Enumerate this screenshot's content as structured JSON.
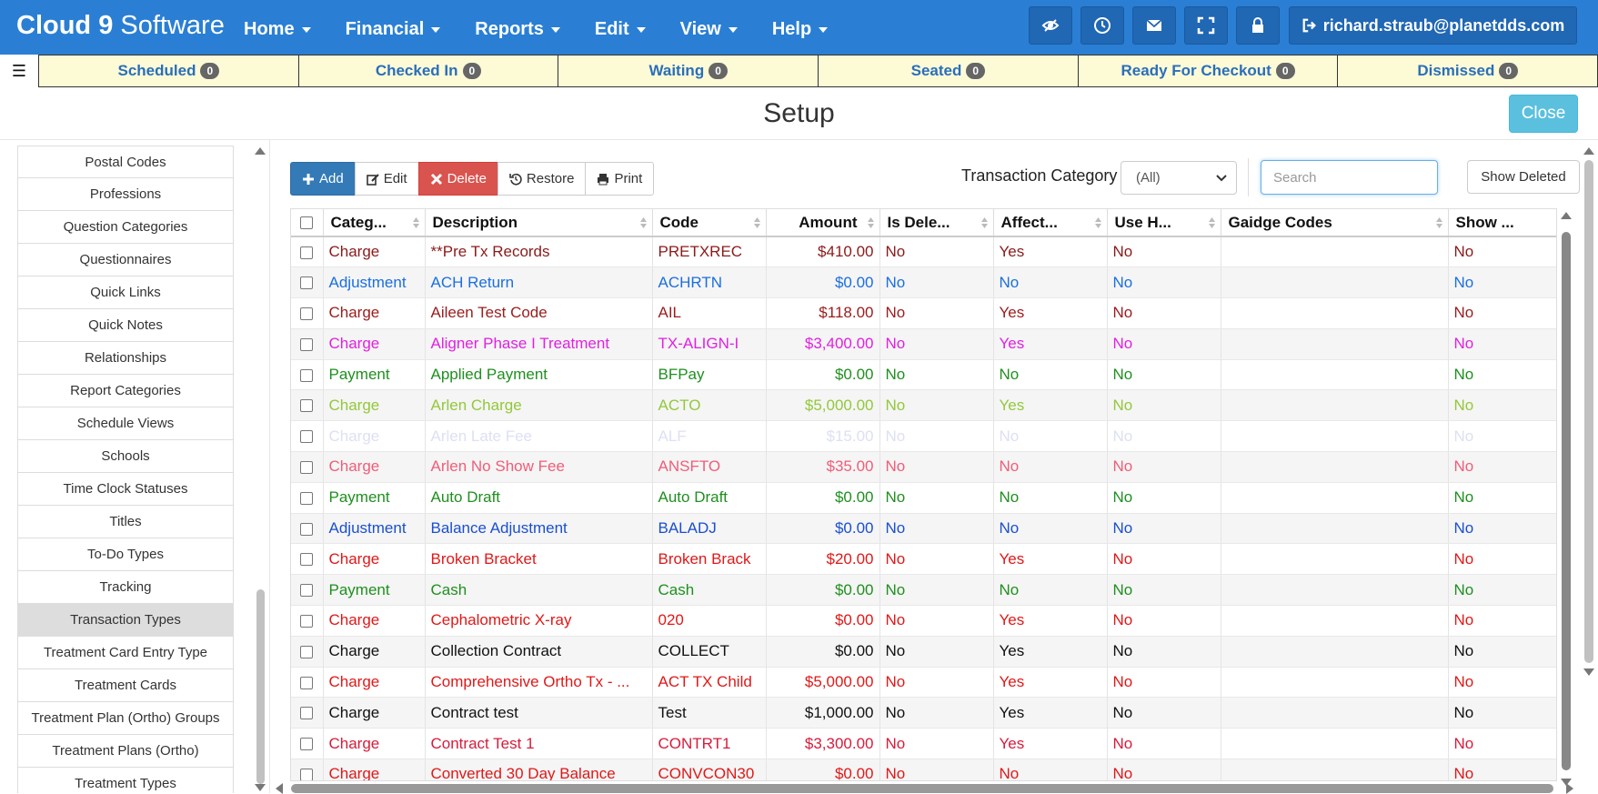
{
  "app": {
    "brand_bold": "Cloud 9",
    "brand_light": " Software",
    "nav": [
      "Home",
      "Financial",
      "Reports",
      "Edit",
      "View",
      "Help"
    ],
    "toolbar_icons": [
      "eye-slash-icon",
      "clock-icon",
      "envelope-icon",
      "fullscreen-icon",
      "lock-icon"
    ],
    "user": "richard.straub@planetdds.com",
    "brand_color": "#2a7fd4"
  },
  "status_bar": [
    {
      "label": "Scheduled",
      "count": "0"
    },
    {
      "label": "Checked In",
      "count": "0"
    },
    {
      "label": "Waiting",
      "count": "0"
    },
    {
      "label": "Seated",
      "count": "0"
    },
    {
      "label": "Ready For Checkout",
      "count": "0"
    },
    {
      "label": "Dismissed",
      "count": "0"
    }
  ],
  "page": {
    "title": "Setup",
    "close_label": "Close"
  },
  "sidebar": {
    "items": [
      "Postal Codes",
      "Professions",
      "Question Categories",
      "Questionnaires",
      "Quick Links",
      "Quick Notes",
      "Relationships",
      "Report Categories",
      "Schedule Views",
      "Schools",
      "Time Clock Statuses",
      "Titles",
      "To-Do Types",
      "Tracking",
      "Transaction Types",
      "Treatment Card Entry Type",
      "Treatment Cards",
      "Treatment Plan (Ortho) Groups",
      "Treatment Plans (Ortho)",
      "Treatment Types"
    ],
    "active": "Transaction Types"
  },
  "toolbar": {
    "add": "Add",
    "edit": "Edit",
    "delete": "Delete",
    "restore": "Restore",
    "print": "Print",
    "filter_label": "Transaction Category",
    "filter_value": "(All)",
    "search_placeholder": "Search",
    "show_deleted": "Show Deleted"
  },
  "grid": {
    "columns": [
      "Categ...",
      "Description",
      "Code",
      "Amount",
      "Is Dele...",
      "Affect...",
      "Use H...",
      "Gaidge Codes",
      "Show ..."
    ],
    "rows": [
      {
        "category": "Charge",
        "description": "**Pre Tx Records",
        "code": "PRETXREC",
        "amount": "$410.00",
        "is_deleted": "No",
        "affects": "Yes",
        "use_h": "No",
        "gaidge": "",
        "show": "No",
        "color": "#8b1a1a"
      },
      {
        "category": "Adjustment",
        "description": "ACH Return",
        "code": "ACHRTN",
        "amount": "$0.00",
        "is_deleted": "No",
        "affects": "No",
        "use_h": "No",
        "gaidge": "",
        "show": "No",
        "color": "#1a6fe0"
      },
      {
        "category": "Charge",
        "description": "Aileen Test Code",
        "code": "AIL",
        "amount": "$118.00",
        "is_deleted": "No",
        "affects": "Yes",
        "use_h": "No",
        "gaidge": "",
        "show": "No",
        "color": "#9b1c1c"
      },
      {
        "category": "Charge",
        "description": "Aligner Phase I Treatment",
        "code": "TX-ALIGN-I",
        "amount": "$3,400.00",
        "is_deleted": "No",
        "affects": "Yes",
        "use_h": "No",
        "gaidge": "",
        "show": "No",
        "color": "#e21fe2"
      },
      {
        "category": "Payment",
        "description": "Applied Payment",
        "code": "BFPay",
        "amount": "$0.00",
        "is_deleted": "No",
        "affects": "No",
        "use_h": "No",
        "gaidge": "",
        "show": "No",
        "color": "#1f8f1f"
      },
      {
        "category": "Charge",
        "description": "Arlen Charge",
        "code": "ACTO",
        "amount": "$5,000.00",
        "is_deleted": "No",
        "affects": "Yes",
        "use_h": "No",
        "gaidge": "",
        "show": "No",
        "color": "#93c83a"
      },
      {
        "category": "Charge",
        "description": "Arlen Late Fee",
        "code": "ALF",
        "amount": "$15.00",
        "is_deleted": "No",
        "affects": "No",
        "use_h": "No",
        "gaidge": "",
        "show": "No",
        "color": "#dde0f3"
      },
      {
        "category": "Charge",
        "description": "Arlen No Show Fee",
        "code": "ANSFTO",
        "amount": "$35.00",
        "is_deleted": "No",
        "affects": "No",
        "use_h": "No",
        "gaidge": "",
        "show": "No",
        "color": "#f05d78"
      },
      {
        "category": "Payment",
        "description": "Auto Draft",
        "code": "Auto Draft",
        "amount": "$0.00",
        "is_deleted": "No",
        "affects": "No",
        "use_h": "No",
        "gaidge": "",
        "show": "No",
        "color": "#1f8f1f"
      },
      {
        "category": "Adjustment",
        "description": "Balance Adjustment",
        "code": "BALADJ",
        "amount": "$0.00",
        "is_deleted": "No",
        "affects": "No",
        "use_h": "No",
        "gaidge": "",
        "show": "No",
        "color": "#1a4fd0"
      },
      {
        "category": "Charge",
        "description": "Broken Bracket",
        "code": "Broken Brack",
        "amount": "$20.00",
        "is_deleted": "No",
        "affects": "Yes",
        "use_h": "No",
        "gaidge": "",
        "show": "No",
        "color": "#e01818"
      },
      {
        "category": "Payment",
        "description": "Cash",
        "code": "Cash",
        "amount": "$0.00",
        "is_deleted": "No",
        "affects": "No",
        "use_h": "No",
        "gaidge": "",
        "show": "No",
        "color": "#1f8f1f"
      },
      {
        "category": "Charge",
        "description": "Cephalometric X-ray",
        "code": "020",
        "amount": "$0.00",
        "is_deleted": "No",
        "affects": "Yes",
        "use_h": "No",
        "gaidge": "",
        "show": "No",
        "color": "#e01818"
      },
      {
        "category": "Charge",
        "description": "Collection Contract",
        "code": "COLLECT",
        "amount": "$0.00",
        "is_deleted": "No",
        "affects": "Yes",
        "use_h": "No",
        "gaidge": "",
        "show": "No",
        "color": "#111111"
      },
      {
        "category": "Charge",
        "description": "Comprehensive Ortho Tx - ...",
        "code": "ACT TX Child",
        "amount": "$5,000.00",
        "is_deleted": "No",
        "affects": "Yes",
        "use_h": "No",
        "gaidge": "",
        "show": "No",
        "color": "#e01818"
      },
      {
        "category": "Charge",
        "description": "Contract test",
        "code": "Test",
        "amount": "$1,000.00",
        "is_deleted": "No",
        "affects": "Yes",
        "use_h": "No",
        "gaidge": "",
        "show": "No",
        "color": "#111111"
      },
      {
        "category": "Charge",
        "description": "Contract Test 1",
        "code": "CONTRT1",
        "amount": "$3,300.00",
        "is_deleted": "No",
        "affects": "Yes",
        "use_h": "No",
        "gaidge": "",
        "show": "No",
        "color": "#d81b3a"
      },
      {
        "category": "Charge",
        "description": "Converted 30 Day Balance",
        "code": "CONVCON30",
        "amount": "$0.00",
        "is_deleted": "No",
        "affects": "No",
        "use_h": "No",
        "gaidge": "",
        "show": "No",
        "color": "#e01818"
      }
    ]
  }
}
